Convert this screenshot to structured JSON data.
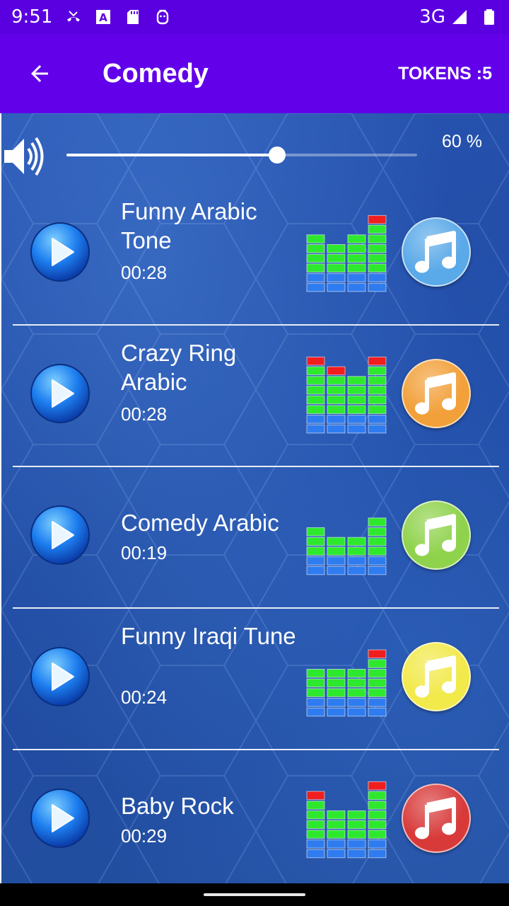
{
  "status_bar": {
    "time": "9:51",
    "network": "3G",
    "icons": [
      "missed-call-icon",
      "font-icon",
      "sd-card-icon",
      "android-icon",
      "signal-icon",
      "battery-icon"
    ]
  },
  "app_bar": {
    "title": "Comedy",
    "tokens": "TOKENS :5",
    "back_icon": "arrow-back-icon"
  },
  "volume": {
    "percent_label": "60 %",
    "level": 0.6,
    "icon": "speaker-icon"
  },
  "songs": [
    {
      "title": "Funny Arabic Tone",
      "duration": "00:28",
      "note_color": "#5aa9e8",
      "eq_levels": [
        6,
        5,
        6,
        8
      ],
      "eq_peaks": [
        false,
        false,
        false,
        true
      ]
    },
    {
      "title": "Crazy Ring Arabic",
      "duration": "00:28",
      "note_color": "#f2a03a",
      "eq_levels": [
        8,
        7,
        6,
        8
      ],
      "eq_peaks": [
        true,
        true,
        false,
        true
      ]
    },
    {
      "title": "Comedy Arabic",
      "duration": "00:19",
      "note_color": "#8fd24c",
      "eq_levels": [
        5,
        4,
        4,
        6
      ],
      "eq_peaks": [
        false,
        false,
        false,
        false
      ]
    },
    {
      "title": "Funny Iraqi Tune",
      "duration": "00:24",
      "note_color": "#f2e94a",
      "eq_levels": [
        5,
        5,
        5,
        7
      ],
      "eq_peaks": [
        false,
        false,
        false,
        true
      ]
    },
    {
      "title": "Baby Rock",
      "duration": "00:29",
      "note_color": "#d83a3a",
      "eq_levels": [
        7,
        5,
        5,
        8
      ],
      "eq_peaks": [
        true,
        false,
        false,
        true
      ]
    }
  ],
  "colors": {
    "status_bar": "#5a00e0",
    "app_bar": "#6200ea",
    "background": "#1e4aa6",
    "eq_green": "#2ee82e",
    "eq_blue": "#2e7cf0",
    "eq_red": "#f01e1e"
  },
  "icons": {
    "play": "play-icon",
    "note": "music-note-icon"
  }
}
